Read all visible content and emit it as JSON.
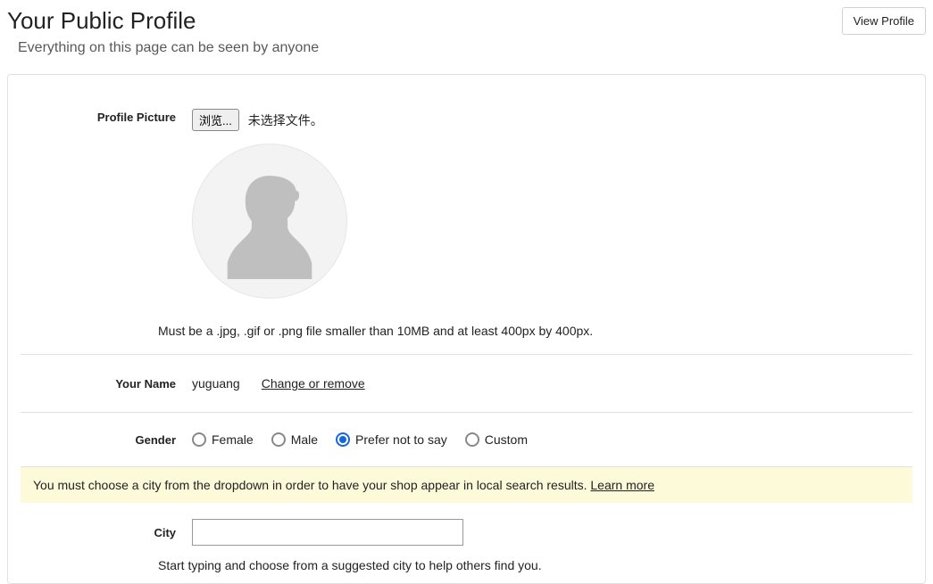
{
  "header": {
    "title": "Your Public Profile",
    "subtitle": "Everything on this page can be seen by anyone",
    "view_profile_label": "View Profile"
  },
  "profile_picture": {
    "label": "Profile Picture",
    "browse_label": "浏览...",
    "no_file_text": "未选择文件。",
    "hint": "Must be a .jpg, .gif or .png file smaller than 10MB and at least 400px by 400px."
  },
  "name": {
    "label": "Your Name",
    "value": "yuguang",
    "change_label": "Change or remove"
  },
  "gender": {
    "label": "Gender",
    "options": {
      "female": "Female",
      "male": "Male",
      "prefer_not": "Prefer not to say",
      "custom": "Custom"
    },
    "selected": "prefer_not"
  },
  "notice": {
    "text": "You must choose a city from the dropdown in order to have your shop appear in local search results. ",
    "learn_more": "Learn more"
  },
  "city": {
    "label": "City",
    "value": "",
    "hint": "Start typing and choose from a suggested city to help others find you."
  }
}
